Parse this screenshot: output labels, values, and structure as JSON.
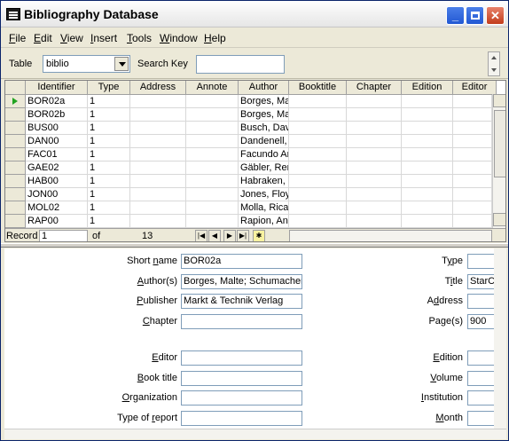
{
  "window": {
    "title": "Bibliography Database"
  },
  "menubar": {
    "items": [
      {
        "label": "File",
        "key": "F",
        "rest": "ile"
      },
      {
        "label": "Edit",
        "key": "E",
        "rest": "dit"
      },
      {
        "label": "View",
        "key": "V",
        "rest": "iew"
      },
      {
        "label": "Insert",
        "key": "I",
        "rest": "nsert"
      },
      {
        "label": "Tools",
        "key": "T",
        "rest": "ools"
      },
      {
        "label": "Window",
        "key": "W",
        "rest": "indow"
      },
      {
        "label": "Help",
        "key": "H",
        "rest": "elp"
      }
    ]
  },
  "toolbar": {
    "table_label": "Table",
    "table_value": "biblio",
    "search_label": "Search Key",
    "search_value": ""
  },
  "grid": {
    "columns": [
      "Identifier",
      "Type",
      "Address",
      "Annote",
      "Author",
      "Booktitle",
      "Chapter",
      "Edition",
      "Editor"
    ],
    "rows": [
      {
        "identifier": "BOR02a",
        "type": "1",
        "author": "Borges, Ma"
      },
      {
        "identifier": "BOR02b",
        "type": "1",
        "author": "Borges, Ma"
      },
      {
        "identifier": "BUS00",
        "type": "1",
        "author": "Busch, Dav"
      },
      {
        "identifier": "DAN00",
        "type": "1",
        "author": "Dandenell,"
      },
      {
        "identifier": "FAC01",
        "type": "1",
        "author": "Facundo Ar"
      },
      {
        "identifier": "GAE02",
        "type": "1",
        "author": "Gäbler, Rer"
      },
      {
        "identifier": "HAB00",
        "type": "1",
        "author": "Habraken,"
      },
      {
        "identifier": "JON00",
        "type": "1",
        "author": "Jones, Floy"
      },
      {
        "identifier": "MOL02",
        "type": "1",
        "author": "Molla, Ricar"
      },
      {
        "identifier": "RAP00",
        "type": "1",
        "author": "Rapion, An"
      }
    ],
    "record_label": "Record",
    "record_value": "1",
    "of_label": "of",
    "total_records": "13"
  },
  "form": {
    "fields_left": [
      {
        "label": "Short name",
        "key": "n",
        "value": "BOR02a"
      },
      {
        "label": "Author(s)",
        "key": "A",
        "value": "Borges, Malte; Schumacher, Jörg"
      },
      {
        "label": "Publisher",
        "key": "P",
        "value": "Markt & Technik Verlag"
      },
      {
        "label": "Chapter",
        "key": "C",
        "value": ""
      }
    ],
    "fields_right": [
      {
        "label": "Type",
        "key": "y",
        "value": ""
      },
      {
        "label": "Title",
        "key": "i",
        "value": "StarC"
      },
      {
        "label": "Address",
        "key": "d",
        "value": ""
      },
      {
        "label": "Page(s)",
        "key": "g",
        "value": "900"
      }
    ],
    "fields_left2": [
      {
        "label": "Editor",
        "key": "E",
        "value": ""
      },
      {
        "label": "Book title",
        "key": "B",
        "value": ""
      },
      {
        "label": "Organization",
        "key": "O",
        "value": ""
      },
      {
        "label": "Type of report",
        "key": "r",
        "value": ""
      }
    ],
    "fields_right2": [
      {
        "label": "Edition",
        "key": "E",
        "value": ""
      },
      {
        "label": "Volume",
        "key": "V",
        "value": ""
      },
      {
        "label": "Institution",
        "key": "I",
        "value": ""
      },
      {
        "label": "Month",
        "key": "M",
        "value": ""
      }
    ]
  }
}
